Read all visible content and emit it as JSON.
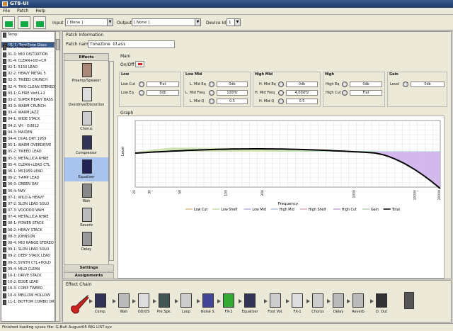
{
  "app": {
    "title": "GT8-UI"
  },
  "menu": [
    "File",
    "Patch",
    "Help"
  ],
  "toolbar": {
    "input_label": "Input",
    "input_value": "[ None ]",
    "output_label": "Output",
    "output_value": "[ None ]",
    "device_label": "Device Id",
    "device_value": "1"
  },
  "patches": [
    "Temp:",
    "01-1: ToneZone Glass",
    "01-2: MUSE2",
    "01-3: MID DISTORTION",
    "01-4: CLEAN+DD+CH",
    "02-1: 5150 LEAD",
    "02-2: HEAVY METAL 5",
    "02-3: TWEED CRUNCH",
    "02-4: TWO CLEAN STEREO",
    "03-1: R-FIRE Vint1+2",
    "03-2: SUPER HEAVY BASS",
    "03-3: WARM CRUNCH",
    "03-4: WARM JAZZ",
    "04-1: WIDE STACK",
    "04-2: VH - OU812",
    "04-3: MAIDEN",
    "04-4: DUAL DRY 1959",
    "05-1: WARM OVERDRIVE",
    "05-2: TWEED LEAD",
    "05-3: METALLICA RHRE",
    "05-4: CLEAN+LEAD CTL",
    "06-1: MS1959 LEAD",
    "06-2: T-AMP LEAD",
    "06-3: GREEN DAY",
    "06-4: MAY",
    "07-1: WILD & HEAVY",
    "07-2: SLDN LEAD SOLO",
    "07-3: VOODOO WAH",
    "07-4: METALLICA RHRE",
    "08-1: POWER STACK",
    "08-2: HEAVY STACK",
    "08-3: JOHNSON",
    "08-4: MID RANGE STEREO",
    "09-1: SLDN LEAD SOLO",
    "09-2: DEEP STACK LEAD",
    "09-3: SYNTH CTL+HOLD",
    "09-4: MILD CLEAN",
    "10-1: DRIVE STACK",
    "10-2: EDGE LEAD",
    "10-3: COMP TWEED",
    "10-4: MELLOW HOLLOW",
    "11-1: BOTTOM COMBO DRV"
  ],
  "patch_info": {
    "header": "Patch Information",
    "name_label": "Patch name",
    "name_value": "ToneZone Glass"
  },
  "effects": {
    "header": "Effects",
    "items": [
      "Preamp/Speaker",
      "Overdrive/Distortion",
      "Chorus",
      "Compressor",
      "Equalizer",
      "Wah",
      "Reverb",
      "Delay"
    ],
    "settings": "Settings",
    "assignments": "Assignments"
  },
  "eq": {
    "main_label": "Main",
    "onoff_label": "On/Off",
    "low": {
      "title": "Low",
      "cut_label": "Low Cut",
      "cut_value": "Flat",
      "eq_label": "Low Eq",
      "eq_value": "0db"
    },
    "lowmid": {
      "title": "Low Mid",
      "eq_label": "L. Mid Eq",
      "eq_value": "0db",
      "freq_label": "L. Mid Freq",
      "freq_value": "100Hz",
      "q_label": "L. Mid Q",
      "q_value": "0.5"
    },
    "highmid": {
      "title": "High Mid",
      "eq_label": "H. Mid Eq",
      "eq_value": "0db",
      "freq_label": "H. Mid Freq",
      "freq_value": "4.00kHz",
      "q_label": "H. Mid Q",
      "q_value": "0.5"
    },
    "high": {
      "title": "High",
      "eq_label": "High Eq",
      "eq_value": "0db",
      "cut_label": "High Cut",
      "cut_value": "Flat"
    },
    "gain": {
      "title": "Gain",
      "level_label": "Level",
      "level_value": "0db"
    }
  },
  "graph": {
    "header": "Graph",
    "ylabel": "Level",
    "xlabel": "Frequency"
  },
  "chart_data": {
    "type": "line",
    "xlabel": "Frequency",
    "ylabel": "Level",
    "x_ticks": [
      "20",
      "30",
      "50",
      "100",
      "200",
      "1000",
      "10000",
      "20000"
    ],
    "legend": [
      "Low Cut",
      "Low Shelf",
      "Low Mid",
      "High Mid",
      "High Shelf",
      "High Cut",
      "Gain",
      "Total"
    ],
    "colors": {
      "total": "#000000",
      "lowshelf": "#c8e0a8",
      "highcut": "#c8a8e8",
      "highmid": "#a8dcc8"
    }
  },
  "effect_chain": {
    "header": "Effect Chain",
    "items": [
      "Comp.",
      "Wah",
      "OD/DS",
      "Pre.Spk.",
      "Loop",
      "Noise S.",
      "FX-2",
      "Equalizer",
      "Foot Vol.",
      "FX-1",
      "Chorus",
      "Delay",
      "Reverb",
      "D. Out"
    ]
  },
  "status": "Finished loading sysex file: G-Bull August05 BIG LIST.syx"
}
